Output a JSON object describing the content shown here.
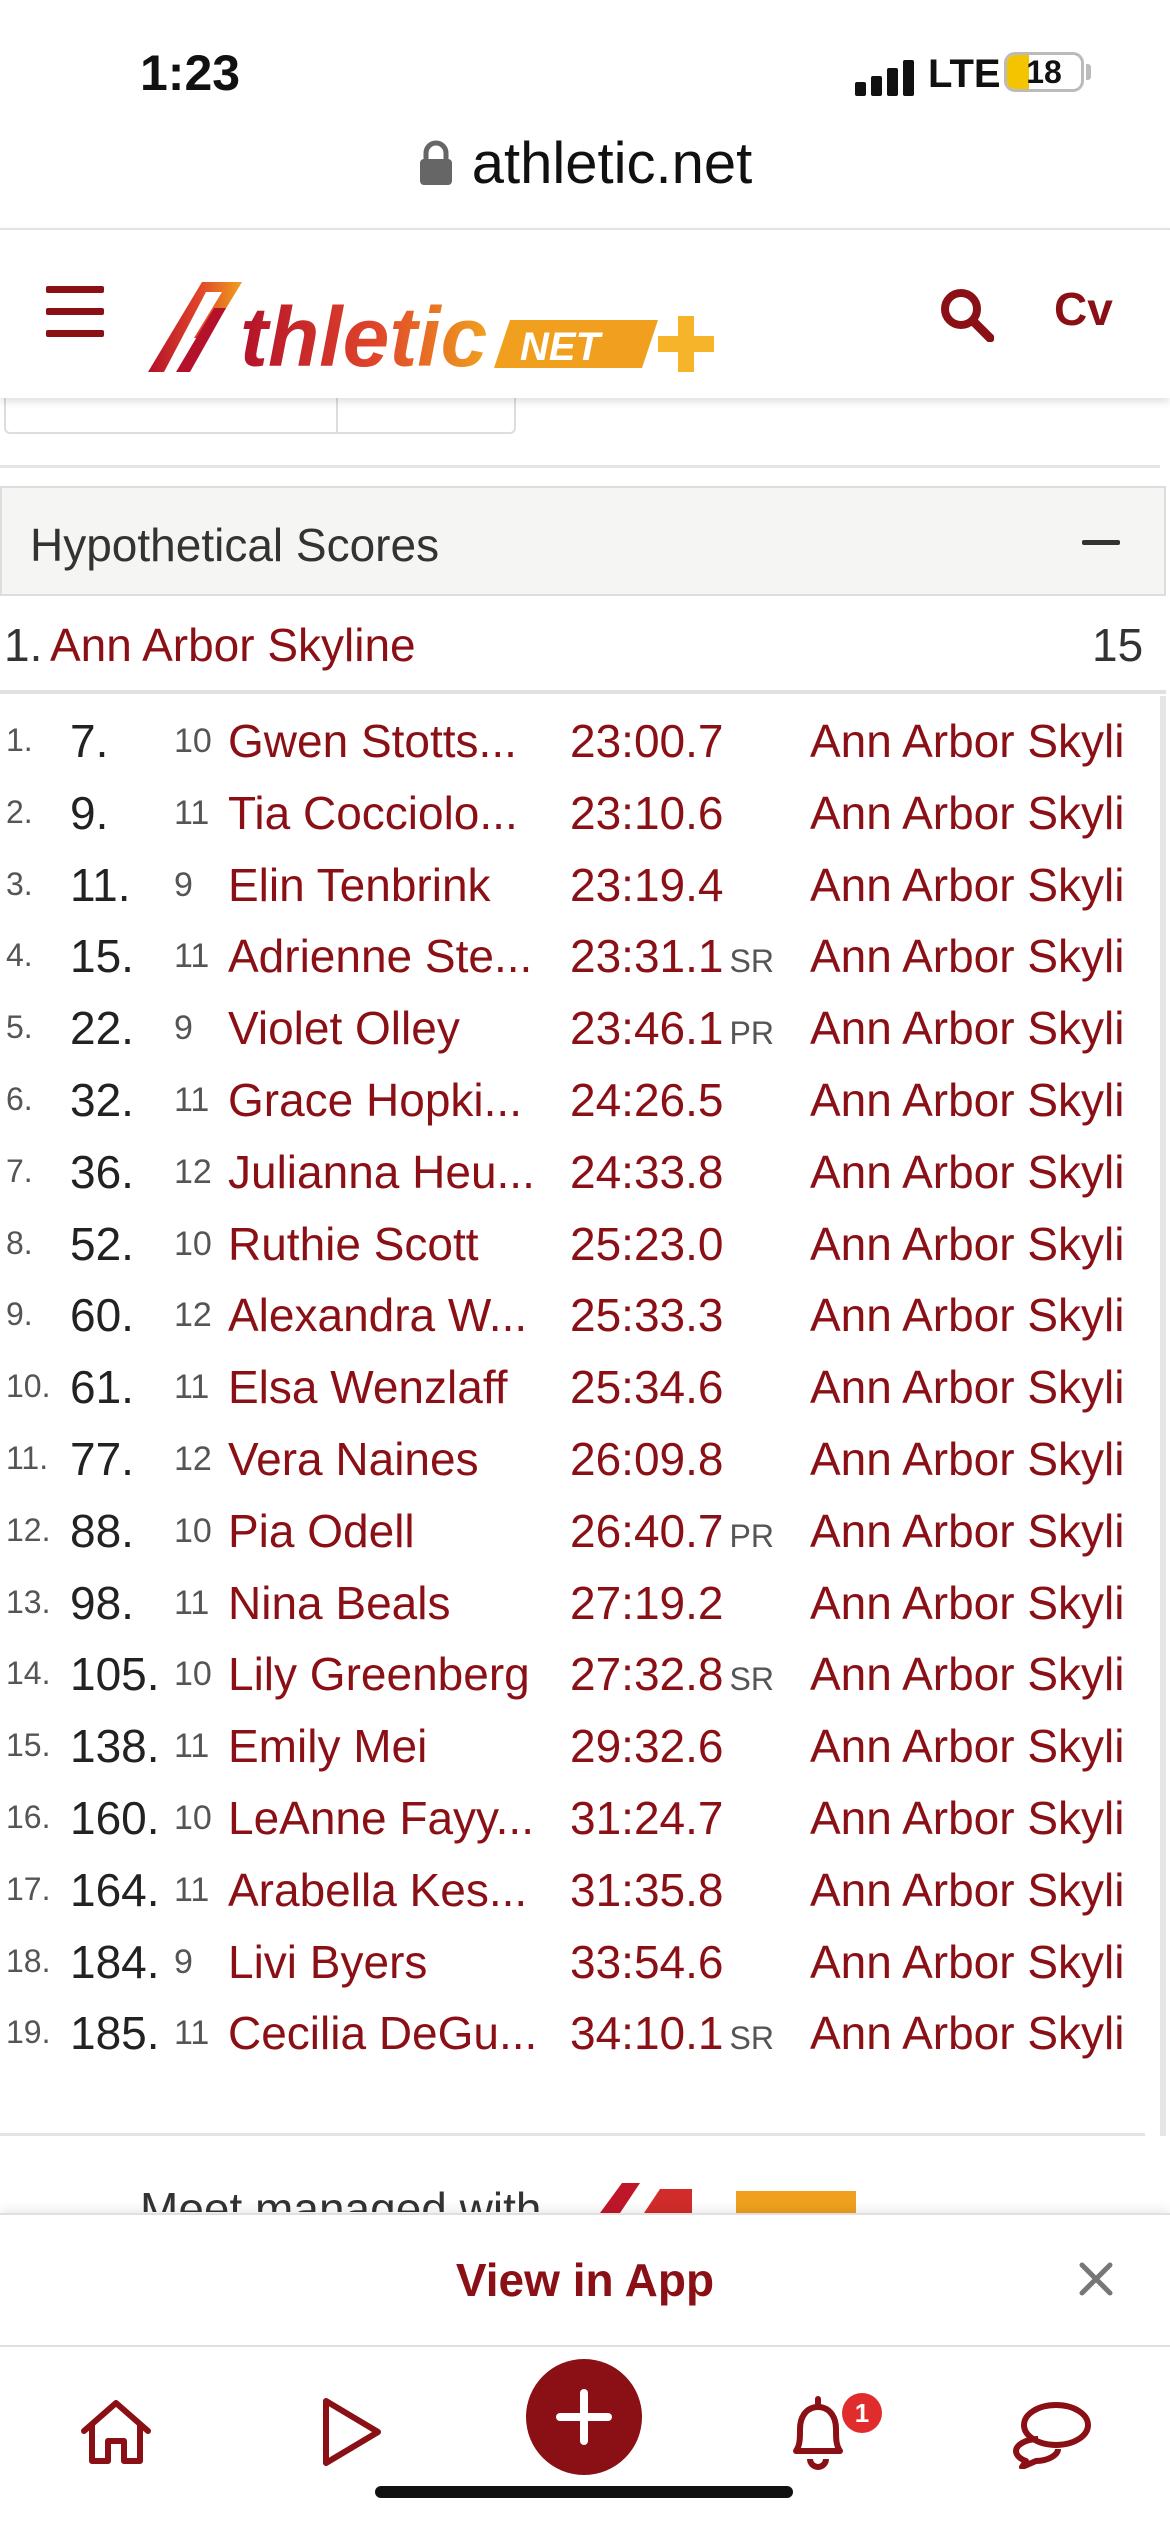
{
  "status_bar": {
    "time": "1:23",
    "network": "LTE",
    "battery": "18"
  },
  "browser": {
    "url": "athletic.net"
  },
  "header": {
    "logo_main": "thletic",
    "logo_net": "NET",
    "account_initials": "Cv"
  },
  "panel": {
    "title": "Hypothetical Scores"
  },
  "team_result": {
    "rank": "1.",
    "team": "Ann Arbor Skyline",
    "score": "15"
  },
  "results": [
    {
      "idx": "1.",
      "place": "7.",
      "grade": "10",
      "name": "Gwen Stotts...",
      "time": "23:00.7",
      "badge": "",
      "team": "Ann Arbor Skyli"
    },
    {
      "idx": "2.",
      "place": "9.",
      "grade": "11",
      "name": "Tia Cocciolo...",
      "time": "23:10.6",
      "badge": "",
      "team": "Ann Arbor Skyli"
    },
    {
      "idx": "3.",
      "place": "11.",
      "grade": "9",
      "name": "Elin Tenbrink",
      "time": "23:19.4",
      "badge": "",
      "team": "Ann Arbor Skyli"
    },
    {
      "idx": "4.",
      "place": "15.",
      "grade": "11",
      "name": "Adrienne Ste...",
      "time": "23:31.1",
      "badge": "SR",
      "team": "Ann Arbor Skyli"
    },
    {
      "idx": "5.",
      "place": "22.",
      "grade": "9",
      "name": "Violet Olley",
      "time": "23:46.1",
      "badge": "PR",
      "team": "Ann Arbor Skyli"
    },
    {
      "idx": "6.",
      "place": "32.",
      "grade": "11",
      "name": "Grace Hopki...",
      "time": "24:26.5",
      "badge": "",
      "team": "Ann Arbor Skyli"
    },
    {
      "idx": "7.",
      "place": "36.",
      "grade": "12",
      "name": "Julianna Heu...",
      "time": "24:33.8",
      "badge": "",
      "team": "Ann Arbor Skyli"
    },
    {
      "idx": "8.",
      "place": "52.",
      "grade": "10",
      "name": "Ruthie Scott",
      "time": "25:23.0",
      "badge": "",
      "team": "Ann Arbor Skyli"
    },
    {
      "idx": "9.",
      "place": "60.",
      "grade": "12",
      "name": "Alexandra W...",
      "time": "25:33.3",
      "badge": "",
      "team": "Ann Arbor Skyli"
    },
    {
      "idx": "10.",
      "place": "61.",
      "grade": "11",
      "name": "Elsa Wenzlaff",
      "time": "25:34.6",
      "badge": "",
      "team": "Ann Arbor Skyli"
    },
    {
      "idx": "11.",
      "place": "77.",
      "grade": "12",
      "name": "Vera Naines",
      "time": "26:09.8",
      "badge": "",
      "team": "Ann Arbor Skyli"
    },
    {
      "idx": "12.",
      "place": "88.",
      "grade": "10",
      "name": "Pia Odell",
      "time": "26:40.7",
      "badge": "PR",
      "team": "Ann Arbor Skyli"
    },
    {
      "idx": "13.",
      "place": "98.",
      "grade": "11",
      "name": "Nina Beals",
      "time": "27:19.2",
      "badge": "",
      "team": "Ann Arbor Skyli"
    },
    {
      "idx": "14.",
      "place": "105.",
      "grade": "10",
      "name": "Lily Greenberg",
      "time": "27:32.8",
      "badge": "SR",
      "team": "Ann Arbor Skyli"
    },
    {
      "idx": "15.",
      "place": "138.",
      "grade": "11",
      "name": "Emily Mei",
      "time": "29:32.6",
      "badge": "",
      "team": "Ann Arbor Skyli"
    },
    {
      "idx": "16.",
      "place": "160.",
      "grade": "10",
      "name": "LeAnne Fayy...",
      "time": "31:24.7",
      "badge": "",
      "team": "Ann Arbor Skyli"
    },
    {
      "idx": "17.",
      "place": "164.",
      "grade": "11",
      "name": "Arabella Kes...",
      "time": "31:35.8",
      "badge": "",
      "team": "Ann Arbor Skyli"
    },
    {
      "idx": "18.",
      "place": "184.",
      "grade": "9",
      "name": "Livi Byers",
      "time": "33:54.6",
      "badge": "",
      "team": "Ann Arbor Skyli"
    },
    {
      "idx": "19.",
      "place": "185.",
      "grade": "11",
      "name": "Cecilia DeGu...",
      "time": "34:10.1",
      "badge": "SR",
      "team": "Ann Arbor Skyli"
    }
  ],
  "footer_partial": {
    "text": "Meet managed with"
  },
  "app_banner": {
    "label": "View in App"
  },
  "bottom_nav": {
    "notification_count": "1"
  },
  "colors": {
    "brand": "#8a1016",
    "logo_gradient_start": "#b3122a",
    "logo_gradient_end": "#f0a01e",
    "accent": "#f6b42a"
  }
}
